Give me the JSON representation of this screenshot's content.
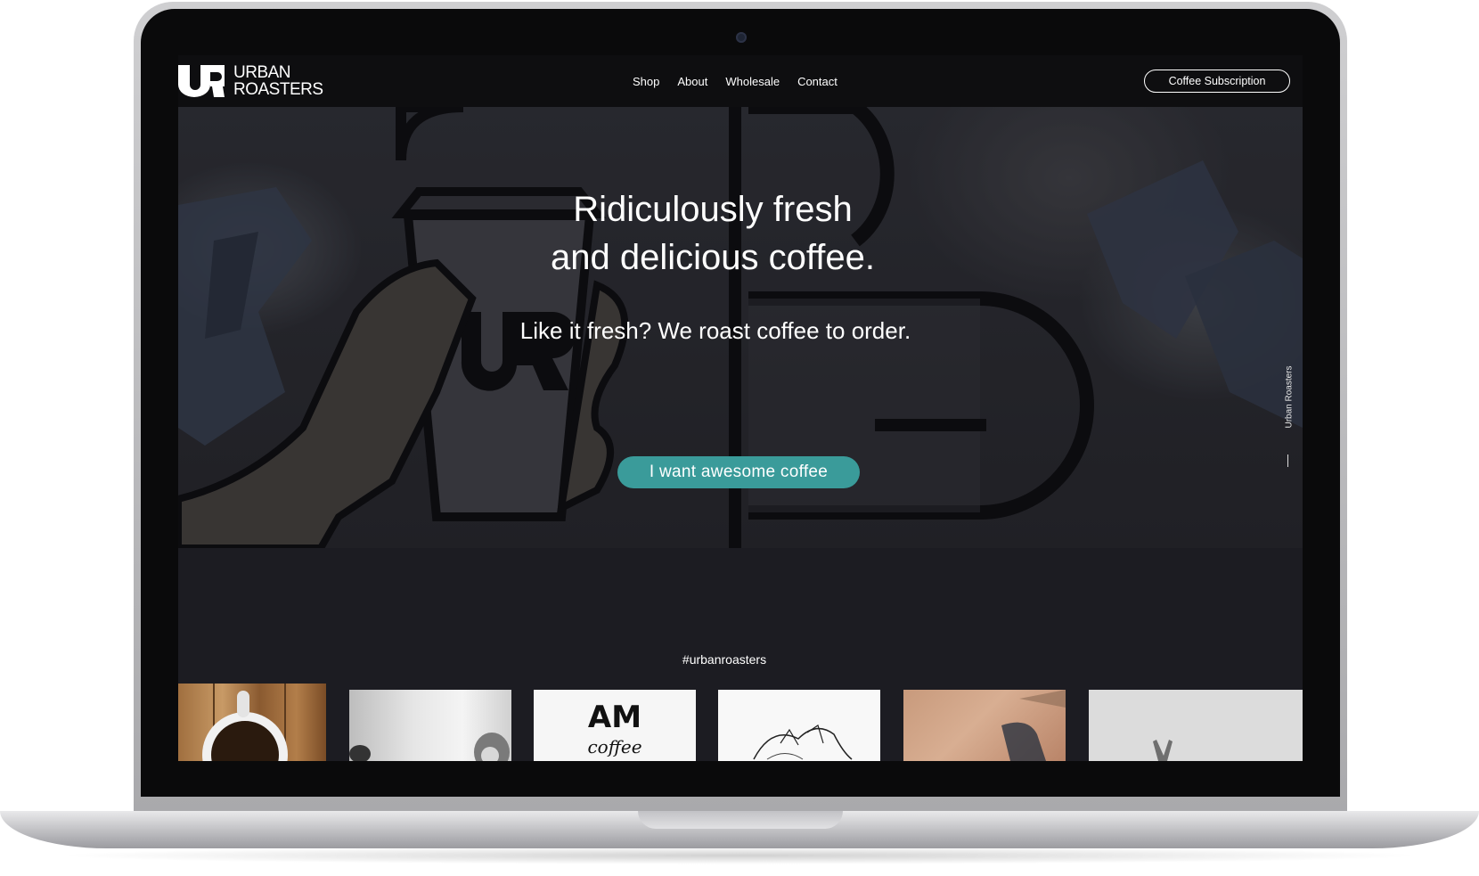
{
  "brand": {
    "line1": "URBAN",
    "line2": "ROASTERS",
    "accent_color": "#3a9b9a"
  },
  "nav": {
    "items": [
      {
        "label": "Shop"
      },
      {
        "label": "About"
      },
      {
        "label": "Wholesale"
      },
      {
        "label": "Contact"
      }
    ],
    "subscription_label": "Coffee Subscription"
  },
  "hero": {
    "title_line1": "Ridiculously fresh",
    "title_line2": "and delicious coffee.",
    "subtitle": "Like it fresh? We roast coffee to order.",
    "cta_label": "I want awesome coffee",
    "side_label": "Urban Roasters"
  },
  "instagram": {
    "hashtag": "#urbanroasters",
    "tiles": [
      {
        "alt": "coffee-cup-photo"
      },
      {
        "alt": "bw-portrait-photo"
      },
      {
        "alt": "am-coffee-lettering"
      },
      {
        "alt": "sketch-illustration"
      },
      {
        "alt": "coffee-bag-photo"
      },
      {
        "alt": "hand-peace-sign-photo"
      }
    ],
    "am_text": "AM",
    "am_text2": "coffee"
  },
  "icons": {
    "logo": "ur-logo-icon",
    "camera": "camera-icon"
  }
}
